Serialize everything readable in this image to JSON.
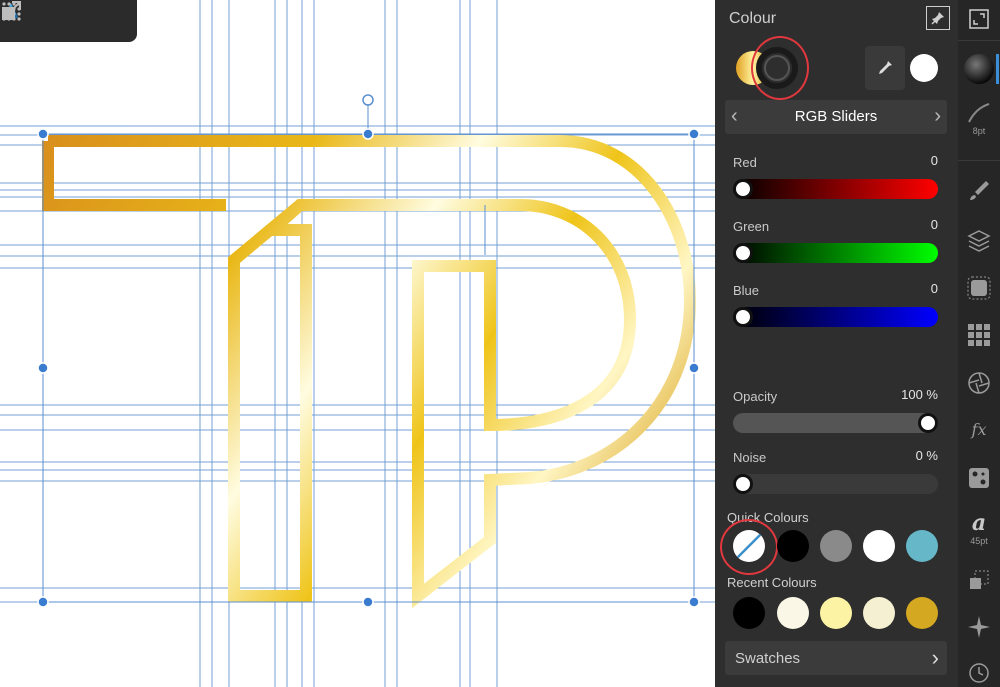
{
  "toolbar": {
    "icons": [
      "affinity-logo-icon",
      "grid-icon",
      "export-persona-icon"
    ]
  },
  "panel": {
    "title": "Colour",
    "mode": "RGB Sliders",
    "sliders": {
      "red": {
        "label": "Red",
        "value": "0",
        "level": 0
      },
      "green": {
        "label": "Green",
        "value": "0",
        "level": 0
      },
      "blue": {
        "label": "Blue",
        "value": "0",
        "level": 0
      },
      "opacity": {
        "label": "Opacity",
        "value": "100 %",
        "level": 1.0
      },
      "noise": {
        "label": "Noise",
        "value": "0 %",
        "level": 0
      }
    },
    "quick_colours_label": "Quick Colours",
    "quick_colours": [
      "none",
      "#000000",
      "#8a8a8a",
      "#ffffff",
      "#66b8c8"
    ],
    "recent_colours_label": "Recent Colours",
    "recent_colours": [
      "#000000",
      "#fbf7e6",
      "#fcf4a4",
      "#f6f0d2",
      "#d4a820"
    ],
    "swatches_label": "Swatches",
    "accent_annotation_color": "#e0383e"
  },
  "strip": {
    "brush_size": "8pt",
    "font_size": "45pt"
  }
}
